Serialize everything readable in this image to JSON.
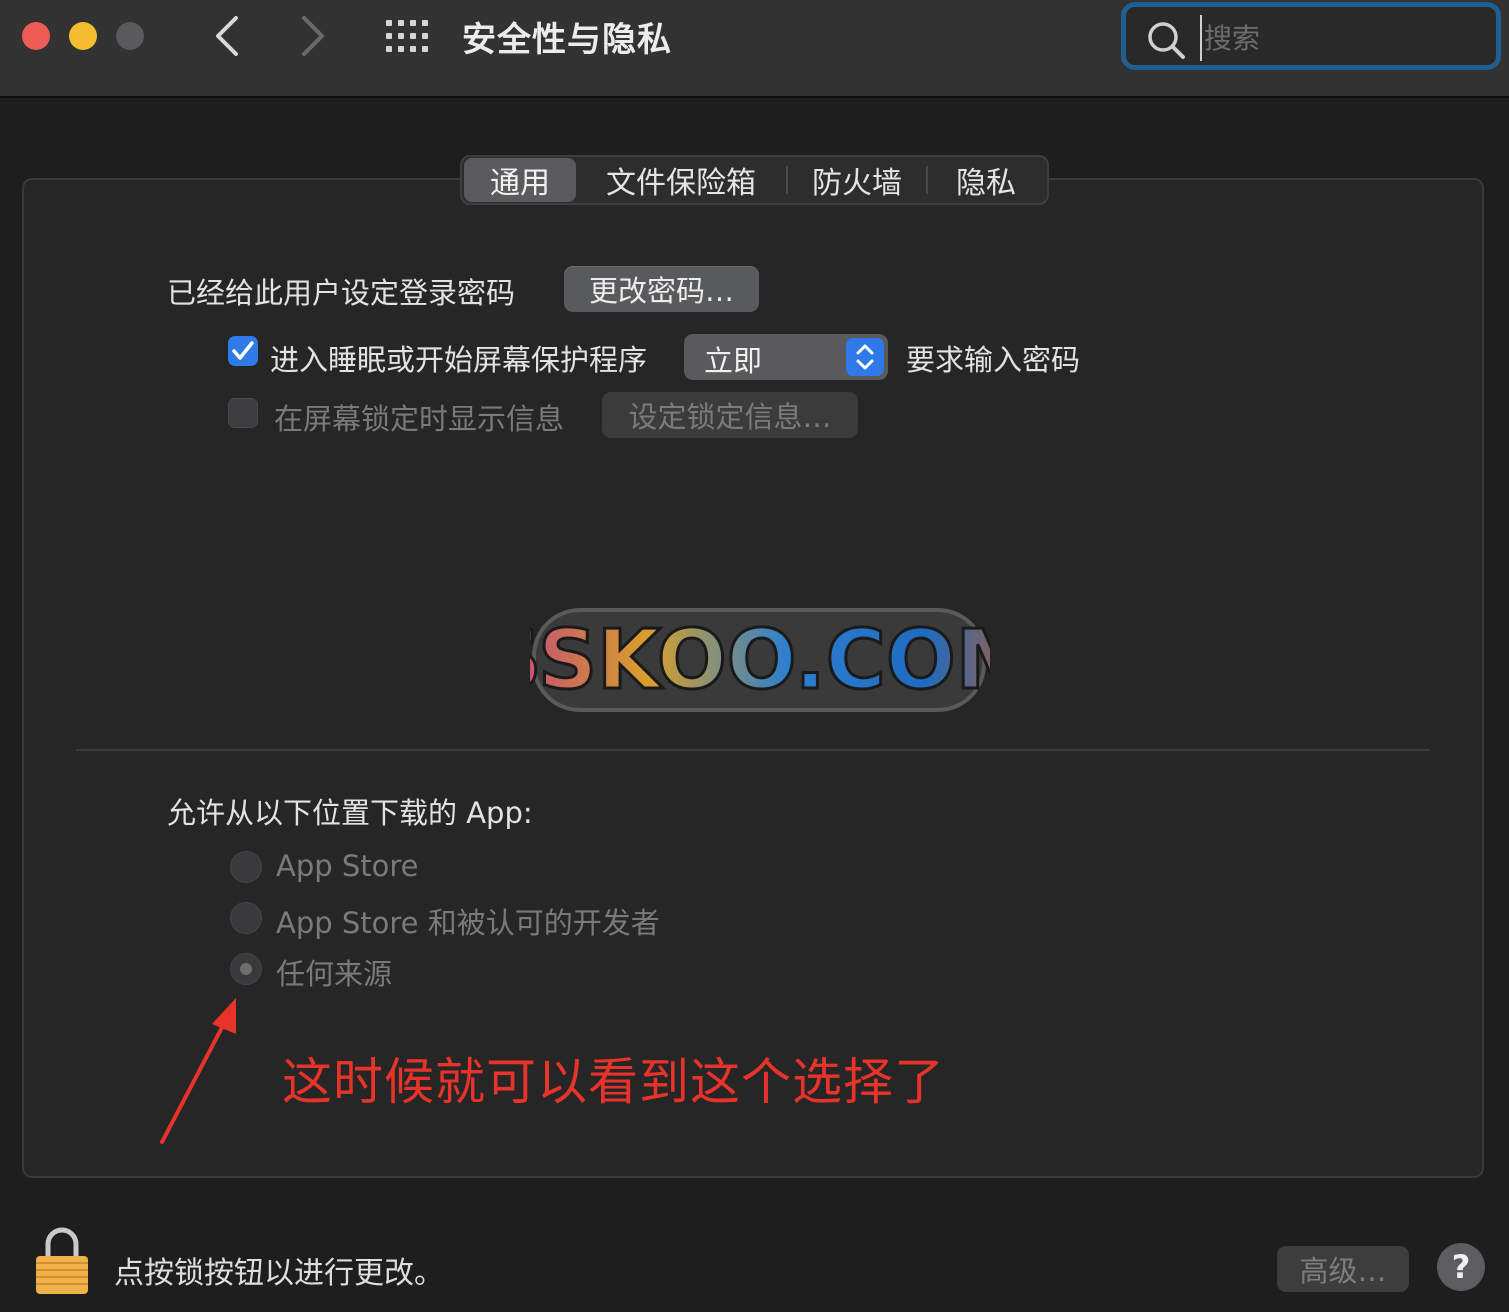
{
  "window": {
    "title": "安全性与隐私",
    "search_placeholder": "搜索"
  },
  "tabs": [
    {
      "label": "通用",
      "active": true
    },
    {
      "label": "文件保险箱",
      "active": false
    },
    {
      "label": "防火墙",
      "active": false
    },
    {
      "label": "隐私",
      "active": false
    }
  ],
  "general": {
    "password_set_label": "已经给此用户设定登录密码",
    "change_password_button": "更改密码…",
    "require_password": {
      "checked": true,
      "label": "进入睡眠或开始屏幕保护程序",
      "delay_value": "立即",
      "suffix": "要求输入密码"
    },
    "lock_message": {
      "checked": false,
      "enabled": false,
      "label": "在屏幕锁定时显示信息",
      "button": "设定锁定信息…"
    }
  },
  "watermark": {
    "text": "SSKOO.COM"
  },
  "downloads": {
    "heading": "允许从以下位置下载的 App:",
    "options": [
      {
        "label": "App Store",
        "selected": false
      },
      {
        "label": "App Store 和被认可的开发者",
        "selected": false
      },
      {
        "label": "任何来源",
        "selected": true
      }
    ]
  },
  "annotation": {
    "text": "这时候就可以看到这个选择了",
    "color": "#e8332b"
  },
  "footer": {
    "lock_text": "点按锁按钮以进行更改。",
    "advanced_button": "高级…",
    "help_button": "?"
  },
  "colors": {
    "accent": "#2d7ae8",
    "focus_ring": "#1f5f92",
    "close": "#ed5d55",
    "minimize": "#f4bd31"
  }
}
